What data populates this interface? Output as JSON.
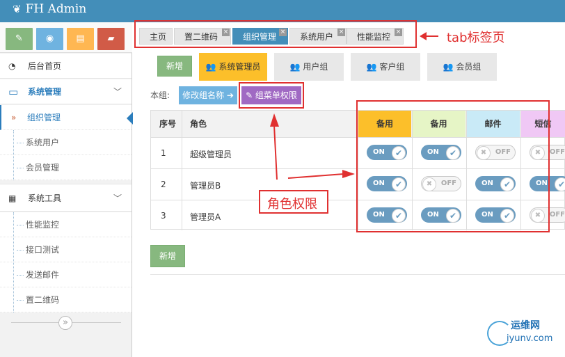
{
  "app": {
    "title": "FH Admin"
  },
  "shortcuts": [
    {
      "icon": "pencil-icon",
      "color": "#87b87f",
      "glyph": "✎"
    },
    {
      "icon": "eye-icon",
      "color": "#6fb3e0",
      "glyph": "◉"
    },
    {
      "icon": "book-icon",
      "color": "#ffb752",
      "glyph": "▤"
    },
    {
      "icon": "folder-icon",
      "color": "#d15b47",
      "glyph": "▰"
    }
  ],
  "sidebar": {
    "home": "后台首页",
    "system_manage": "系统管理",
    "system_manage_items": [
      "组织管理",
      "系统用户",
      "会员管理"
    ],
    "system_tools": "系统工具",
    "system_tools_items": [
      "性能监控",
      "接口测试",
      "发送邮件",
      "置二维码"
    ],
    "collapse_glyph": "»"
  },
  "tabs": [
    {
      "label": "主页"
    },
    {
      "label": "置二维码"
    },
    {
      "label": "组织管理"
    },
    {
      "label": "系统用户"
    },
    {
      "label": "性能监控"
    }
  ],
  "close_glyph": "×",
  "group_tabs": [
    "系统管理员",
    "用户组",
    "客户组",
    "会员组"
  ],
  "toolbar": {
    "add_label": "新增",
    "group_label": "本组:",
    "rename_label": "修改组名称 ➔",
    "menu_perm_label": "✎ 组菜单权限"
  },
  "table": {
    "headers": [
      "序号",
      "角色"
    ],
    "perm_headers": [
      {
        "label": "备用",
        "color": "#fcbf2a"
      },
      {
        "label": "备用",
        "color": "#e6f5c6"
      },
      {
        "label": "邮件",
        "color": "#c9eaf7"
      },
      {
        "label": "短信",
        "color": "#f0c8f5"
      }
    ],
    "rows": [
      {
        "no": "1",
        "role": "超级管理员",
        "perms": [
          true,
          true,
          false,
          false
        ]
      },
      {
        "no": "2",
        "role": "管理员B",
        "perms": [
          true,
          false,
          true,
          true
        ]
      },
      {
        "no": "3",
        "role": "管理员A",
        "perms": [
          true,
          true,
          true,
          false
        ]
      }
    ],
    "on_label": "ON",
    "off_label": "OFF"
  },
  "bottom": {
    "add_label": "新增"
  },
  "annotations": {
    "tab_label": "tab标签页",
    "role_perm_label": "角色权限"
  },
  "watermark": {
    "top": "运维网",
    "bottom": "iyunv.com"
  }
}
